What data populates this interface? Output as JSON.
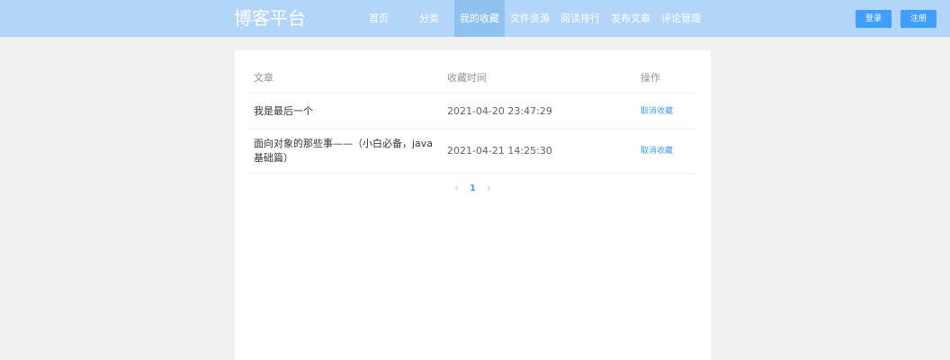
{
  "header": {
    "brand": "博客平台",
    "nav": [
      {
        "label": "首页",
        "active": false
      },
      {
        "label": "分类",
        "active": false
      },
      {
        "label": "我的收藏",
        "active": true
      },
      {
        "label": "文件资源",
        "active": false
      },
      {
        "label": "阅读排行",
        "active": false
      },
      {
        "label": "发布文章",
        "active": false
      },
      {
        "label": "评论管理",
        "active": false
      }
    ],
    "login_label": "登录",
    "register_label": "注册"
  },
  "table": {
    "columns": [
      "文章",
      "收藏时间",
      "操作"
    ],
    "rows": [
      {
        "title": "我是最后一个",
        "time": "2021-04-20 23:47:29",
        "action": "取消收藏"
      },
      {
        "title": "面向对象的那些事——（小白必备，java基础篇）",
        "time": "2021-04-21 14:25:30",
        "action": "取消收藏"
      }
    ]
  },
  "pagination": {
    "prev_icon": "chevron-left",
    "next_icon": "chevron-right",
    "current_page": "1"
  },
  "colors": {
    "header_bg": "#b3d5fa",
    "active_nav_bg": "#8fc2f0",
    "accent": "#409eff"
  }
}
